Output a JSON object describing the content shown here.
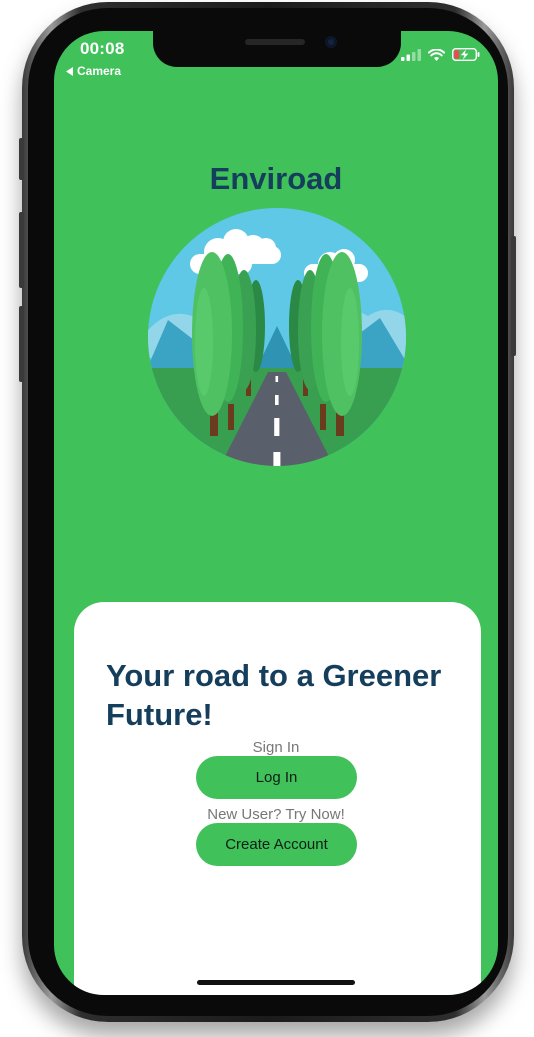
{
  "status_bar": {
    "time": "00:08",
    "back_label": "Camera"
  },
  "app": {
    "title": "Enviroad"
  },
  "welcome": {
    "tagline": "Your road to a Greener Future!",
    "signin_hint": "Sign In",
    "login_button": "Log In",
    "new_user_hint": "New User? Try Now!",
    "create_button": "Create Account"
  },
  "icons": [
    "back-arrow-icon",
    "cellular-signal-icon",
    "wifi-icon",
    "battery-charging-icon"
  ],
  "colors": {
    "background": "#40c15a",
    "card": "#ffffff",
    "title_text": "#153e5c",
    "button": "#40c15a",
    "hint_text": "#777777"
  }
}
